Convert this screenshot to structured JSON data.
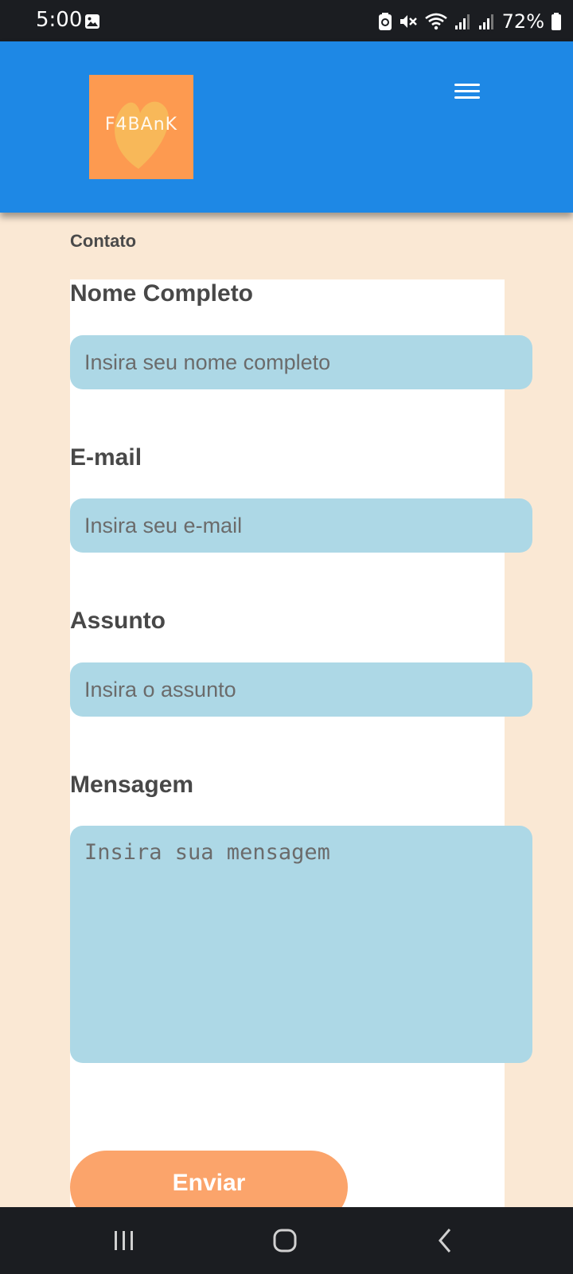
{
  "status_bar": {
    "time": "5:00",
    "battery": "72%"
  },
  "header": {
    "logo_text": "F4BAnK",
    "logo_color": "#fd9a50",
    "bar_color": "#1e88e5"
  },
  "breadcrumb": "Contato",
  "form": {
    "name_label": "Nome Completo",
    "name_placeholder": "Insira seu nome completo",
    "email_label": "E-mail",
    "email_placeholder": "Insira seu e-mail",
    "subject_label": "Assunto",
    "subject_placeholder": "Insira o assunto",
    "message_label": "Mensagem",
    "message_placeholder": "Insira sua mensagem",
    "submit_label": "Enviar",
    "input_color": "#add8e6",
    "button_color": "#fba46b"
  },
  "icons": {
    "status_left": "image-icon",
    "status_right": [
      "battery-saver-icon",
      "mute-icon",
      "wifi-icon",
      "signal-icon",
      "signal-icon",
      "battery-icon"
    ],
    "menu": "hamburger-menu-icon",
    "nav": [
      "recents-icon",
      "home-icon",
      "back-icon"
    ]
  }
}
